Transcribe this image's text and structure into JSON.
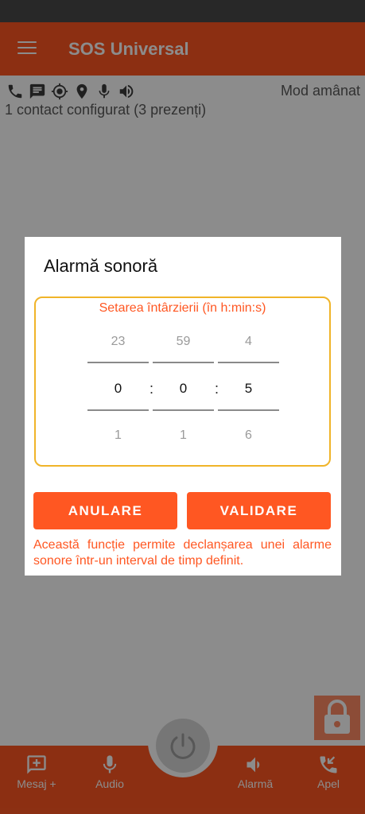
{
  "app": {
    "title": "SOS Universal"
  },
  "status": {
    "mode": "Mod amânat",
    "contacts": "1 contact configurat (3 prezenți)"
  },
  "status_icons": [
    "phone-icon",
    "message-icon",
    "gps-target-icon",
    "location-pin-icon",
    "microphone-icon",
    "speaker-icon"
  ],
  "dialog": {
    "title": "Alarmă sonoră",
    "picker_caption": "Setarea întârzierii (în h:min:s)",
    "hours": {
      "prev": "23",
      "current": "0",
      "next": "1"
    },
    "minutes": {
      "prev": "59",
      "current": "0",
      "next": "1"
    },
    "seconds": {
      "prev": "4",
      "current": "5",
      "next": "6"
    },
    "separator": ":",
    "cancel_label": "ANULARE",
    "confirm_label": "VALIDARE",
    "info": "Această funcție permite declanșarea unei alarme sonore într-un interval de timp definit."
  },
  "bottom_nav": {
    "message": "Mesaj +",
    "audio": "Audio",
    "alarm": "Alarmă",
    "call": "Apel"
  },
  "colors": {
    "accent": "#ff5722",
    "picker_border": "#f0b429",
    "overlay": "rgba(0,0,0,0.45)"
  }
}
